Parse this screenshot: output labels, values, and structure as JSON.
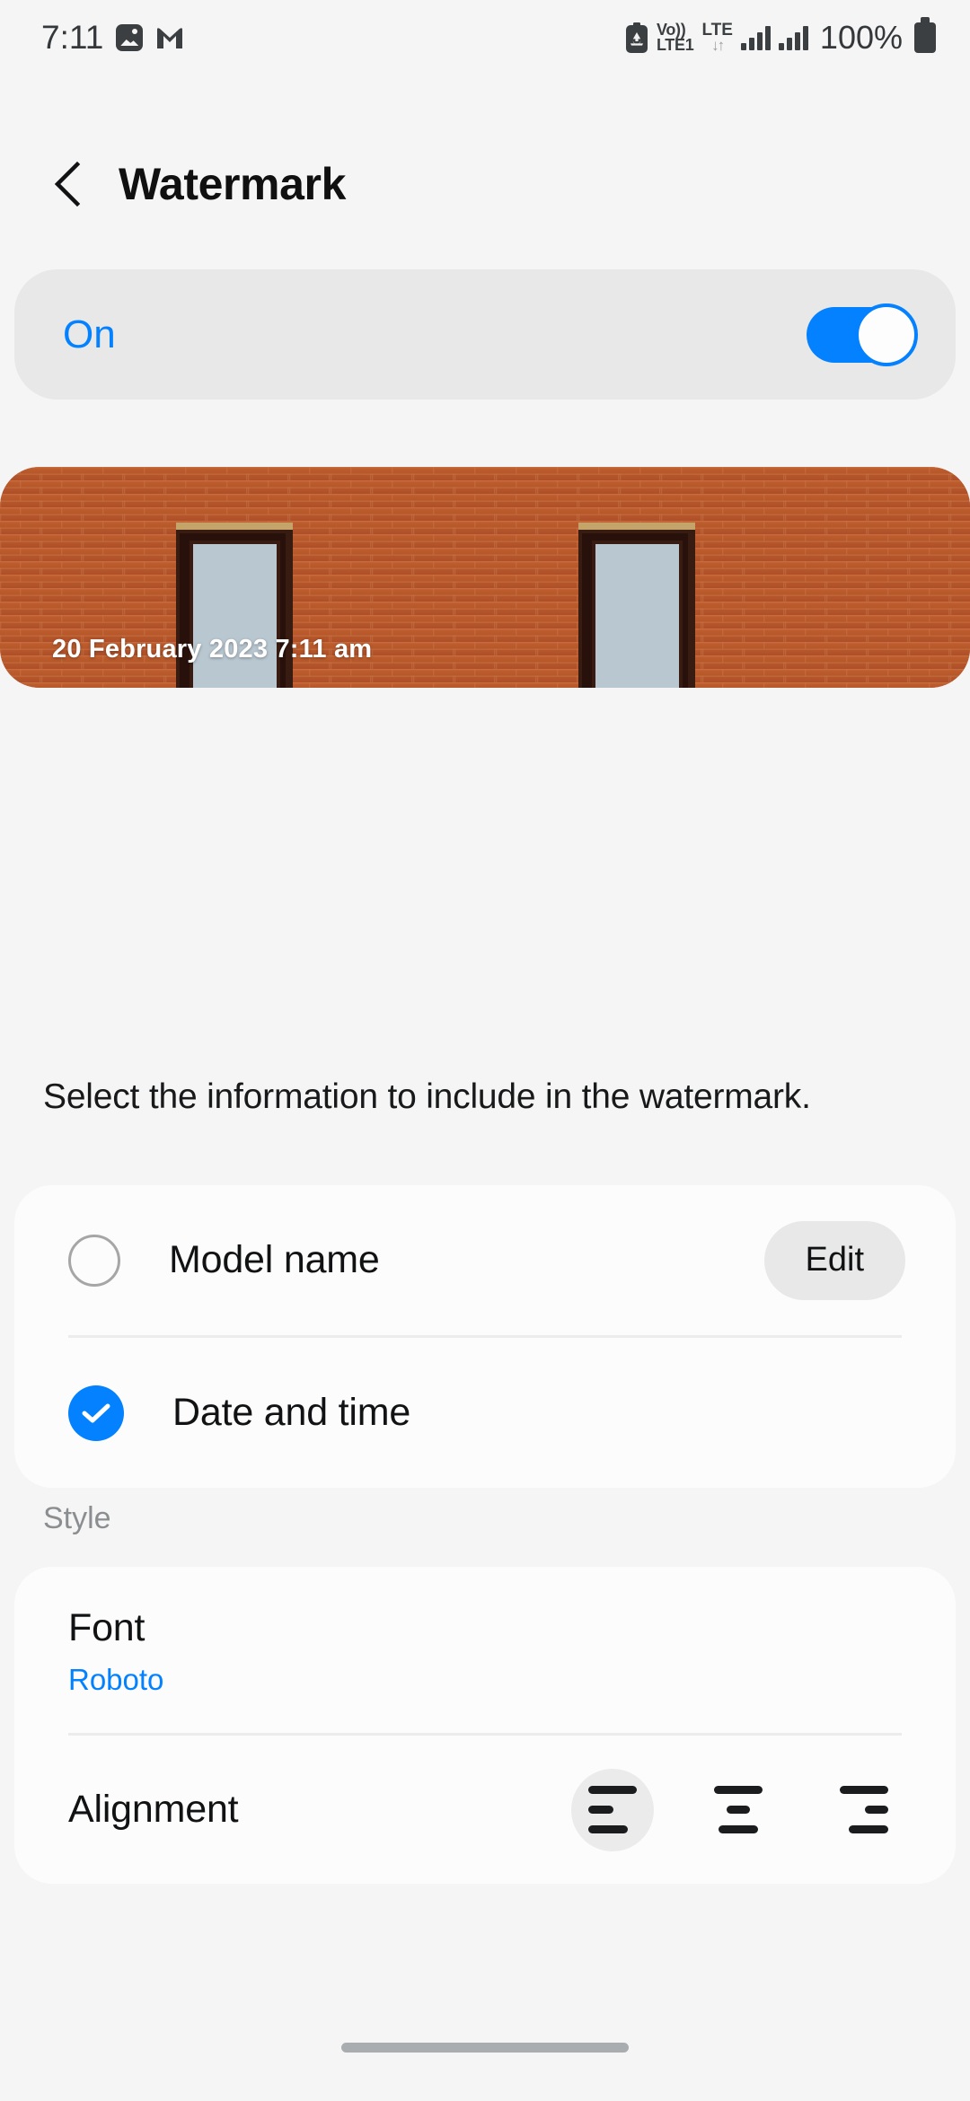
{
  "status_bar": {
    "clock": "7:11",
    "battery_percent": "100%",
    "volte_label_top": "Vo))",
    "volte_label_bottom": "LTE1",
    "lte_label": "LTE",
    "data_arrows": "↓↑",
    "icons": [
      "gallery-icon",
      "gmail-icon",
      "battery-saver-icon",
      "volte-icon",
      "lte-icon",
      "signal-icon-1",
      "signal-icon-2",
      "battery-icon"
    ]
  },
  "header": {
    "title": "Watermark",
    "back_icon": "back-chevron-icon"
  },
  "master_toggle": {
    "label": "On",
    "enabled": true,
    "accent_color": "#0381fe"
  },
  "preview": {
    "watermark_text": "20 February 2023 7:11 am",
    "image_description": "brick-wall-with-two-windows"
  },
  "description": "Select the information to include in the watermark.",
  "options": {
    "items": [
      {
        "label": "Model name",
        "checked": false,
        "action_label": "Edit"
      },
      {
        "label": "Date and time",
        "checked": true
      }
    ]
  },
  "style": {
    "section_label": "Style",
    "font": {
      "title": "Font",
      "value": "Roboto"
    },
    "alignment": {
      "label": "Alignment",
      "selected": 0,
      "options": [
        "align-left",
        "align-center",
        "align-right"
      ]
    }
  },
  "nav_bar": {
    "home_indicator": "home-indicator"
  }
}
